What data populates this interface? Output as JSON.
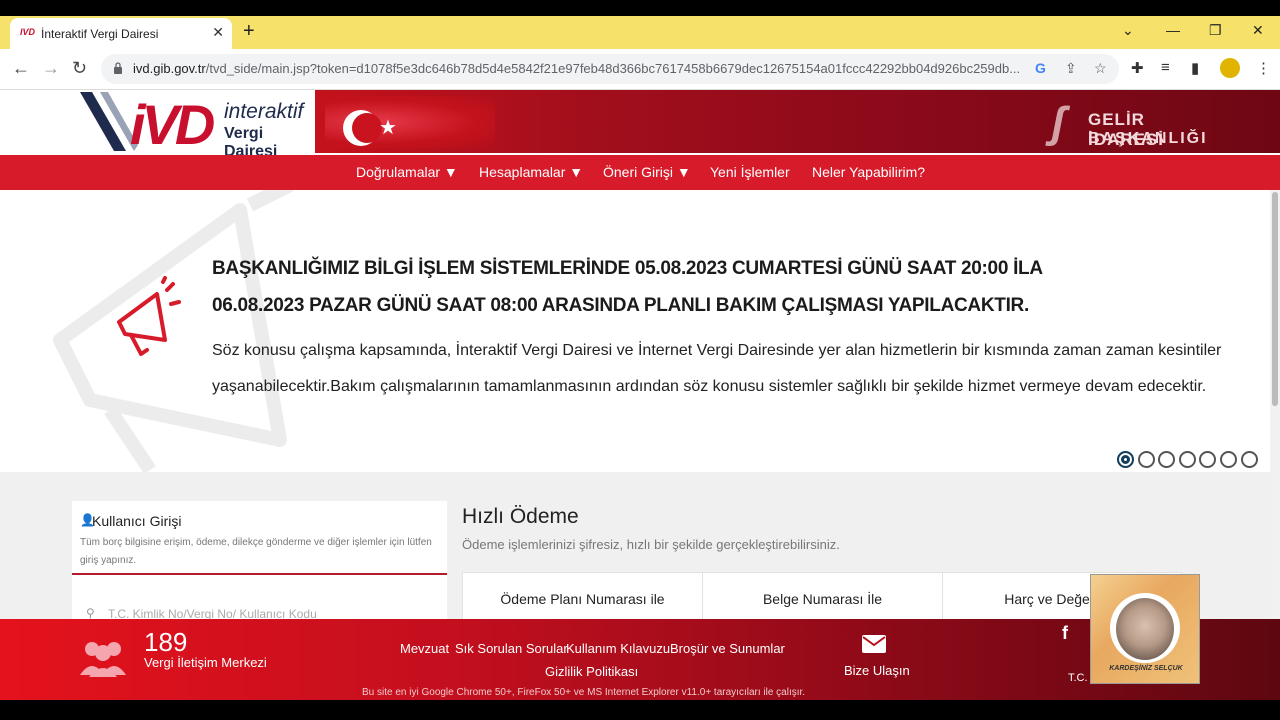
{
  "browser": {
    "tab_title": "İnteraktif Vergi Dairesi",
    "tab_favicon": "IVD",
    "url_domain": "ivd.gib.gov.tr",
    "url_rest": "/tvd_side/main.jsp?token=d1078f5e3dc646b78d5d4e5842f21e97feb48d366bc7617458b6679dec12675154a01fccc42292bb04d926bc259db..."
  },
  "header": {
    "logo_letters": "iVD",
    "logo_line1": "interaktif",
    "logo_line2": "Vergi Dairesi",
    "gib_line1": "GELİR İDARESİ",
    "gib_line2": "BAŞKANLIĞI"
  },
  "menu": {
    "items": [
      {
        "label": "Doğrulamalar ▼"
      },
      {
        "label": "Hesaplamalar ▼"
      },
      {
        "label": "Öneri Girişi ▼"
      },
      {
        "label": "Yeni İşlemler"
      },
      {
        "label": "Neler Yapabilirim?"
      }
    ]
  },
  "announcement": {
    "title_line1": "BAŞKANLIĞIMIZ BİLGİ İŞLEM SİSTEMLERİNDE 05.08.2023 CUMARTESİ GÜNÜ SAAT 20:00 İLA",
    "title_line2": "06.08.2023 PAZAR GÜNÜ SAAT 08:00 ARASINDA PLANLI BAKIM ÇALIŞMASI YAPILACAKTIR.",
    "body_line1": "Söz konusu çalışma kapsamında, İnteraktif Vergi Dairesi ve İnternet Vergi Dairesinde yer alan hizmetlerin bir kısmında zaman zaman kesintiler",
    "body_line2": "yaşanabilecektir.Bakım çalışmalarının tamamlanmasının ardından söz konusu sistemler sağlıklı bir şekilde hizmet vermeye devam edecektir.",
    "slide_count": 7,
    "active_slide": 1
  },
  "login": {
    "title": "Kullanıcı Girişi",
    "description": "Tüm borç bilgisine erişim, ödeme, dilekçe gönderme ve diğer işlemler için lütfen giriş yapınız.",
    "field_placeholder": "T.C. Kimlik No/Vergi No/ Kullanıcı Kodu"
  },
  "payment": {
    "title": "Hızlı Ödeme",
    "subtitle": "Ödeme işlemlerinizi şifresiz, hızlı bir şekilde gerçekleştirebilirsiniz.",
    "options": [
      {
        "label": "Ödeme Planı Numarası ile"
      },
      {
        "label": "Belge Numarası İle"
      },
      {
        "label": "Harç ve Değerli Ka"
      }
    ]
  },
  "footer": {
    "call_number": "189",
    "call_label": "Vergi İletişim Merkezi",
    "links": [
      "Mevzuat",
      "Sık Sorulan Sorular",
      "Kullanım Kılavuzu",
      "Broşür ve Sunumlar",
      "Gizlilik Politikası"
    ],
    "contact": "Bize Ulaşın",
    "note": "Bu site en iyi Google Chrome 50+, FireFox 50+ ve MS Internet Explorer v11.0+ tarayıcıları ile çalışır.",
    "facebook": "f",
    "tc_text": "T.C."
  },
  "webcam": {
    "caption": "KARDEŞİNİZ SELÇUK"
  },
  "colors": {
    "brand_red": "#d81b2b",
    "dark_red": "#6e0713",
    "tab_bar": "#f6e26a"
  }
}
